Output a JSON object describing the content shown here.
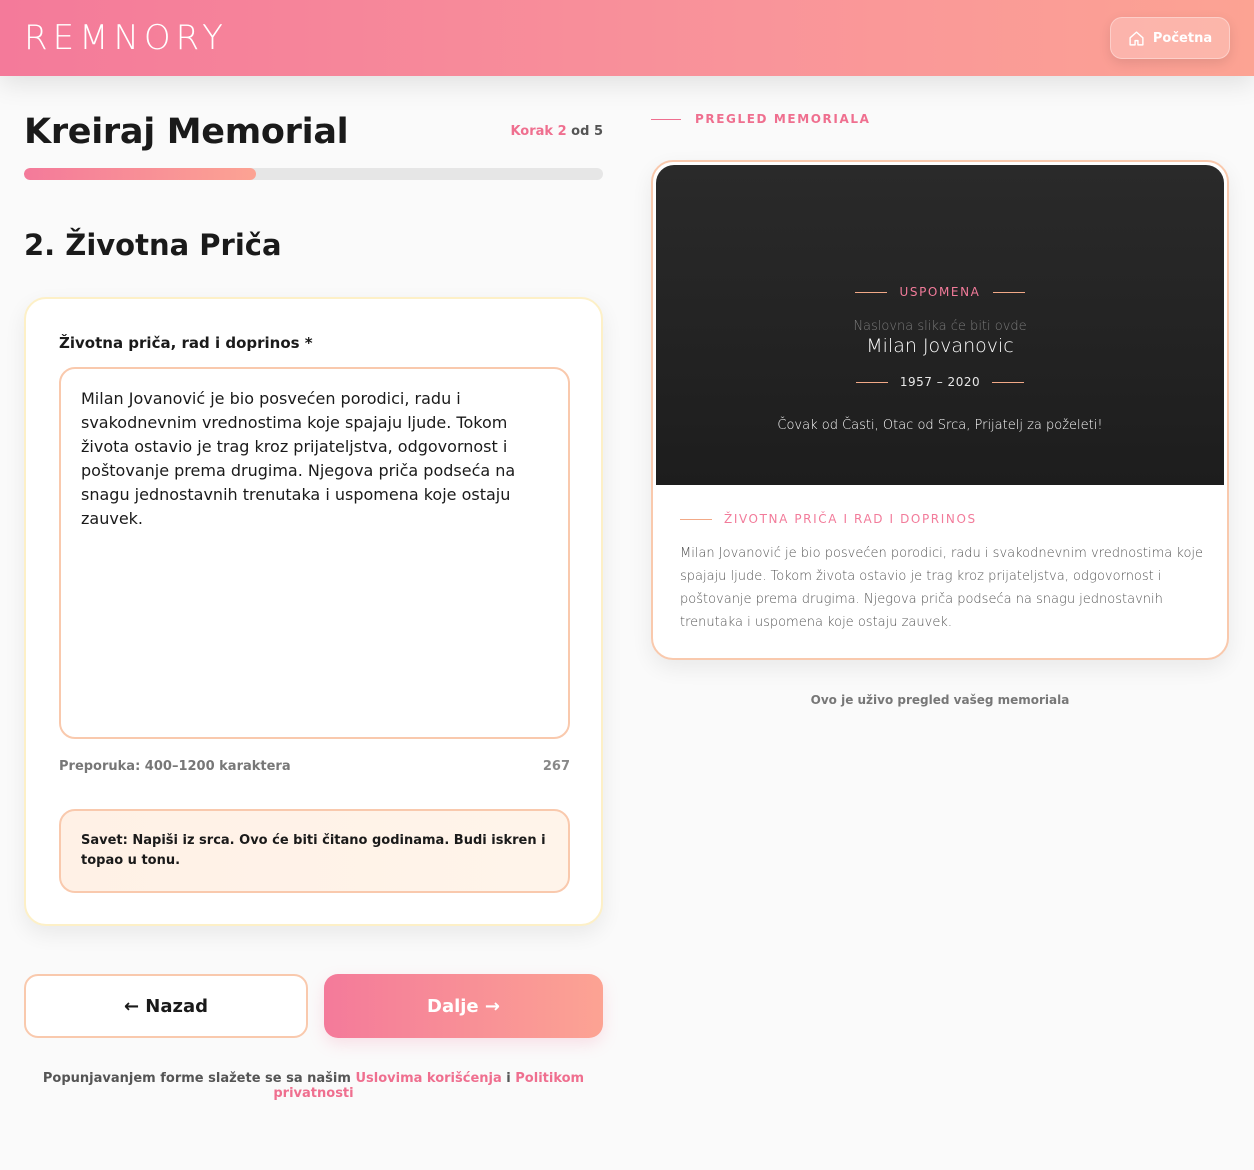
{
  "header": {
    "logo_text": "REMNORY",
    "home_label": "Početna",
    "home_icon": "home-icon"
  },
  "form": {
    "title": "Kreiraj Memorial",
    "step_prefix": "Korak",
    "step_current": "2",
    "step_separator": "od",
    "step_total": "5",
    "progress_fraction": 0.4,
    "section_title": "2. Životna Priča",
    "field_label": "Životna priča, rad i doprinos *",
    "story_value": "Milan Jovanović je bio posvećen porodici, radu i svakodnevnim vrednostima koje spajaju ljude. Tokom života ostavio je trag kroz prijateljstva, odgovornost i poštovanje prema drugima. Njegova priča podseća na snagu jednostavnih trenutaka i uspomena koje ostaju zauvek.",
    "hint": "Preporuka: 400–1200 karaktera",
    "char_count": "267",
    "tip": "Savet: Napiši iz srca. Ovo će biti čitano godinama. Budi iskren i topao u tonu.",
    "back_label": "← Nazad",
    "next_label": "Dalje →",
    "consent_prefix": "Popunjavanjem forme slažete se sa našim",
    "consent_terms": "Uslovima korišćenja",
    "consent_and": "i",
    "consent_privacy": "Politikom privatnosti"
  },
  "preview": {
    "label": "PREGLED MEMORIALA",
    "tag": "USPOMENA",
    "placeholder": "Naslovna slika će biti ovde",
    "name": "Milan Jovanovic",
    "dates": "1957 – 2020",
    "quote": "Čovak od Časti, Otac od Srca, Prijatelj za poželeti!",
    "story_tag": "ŽIVOTNA PRIČA I RAD I DOPRINOS",
    "story_text": "Milan Jovanović je bio posvećen porodici, radu i svakodnevnim vrednostima koje spajaju ljude. Tokom života ostavio je trag kroz prijateljstva, odgovornost i poštovanje prema drugima. Njegova priča podseća na snagu jednostavnih trenutaka i uspomena koje ostaju zauvek.",
    "live_note": "Ovo je uživo pregled vašeg memoriala"
  },
  "colors": {
    "accent": "#ef6f8f",
    "gradient_start": "#f47a9a",
    "gradient_end": "#fca393",
    "hero_bg": "#1d1d1d"
  }
}
